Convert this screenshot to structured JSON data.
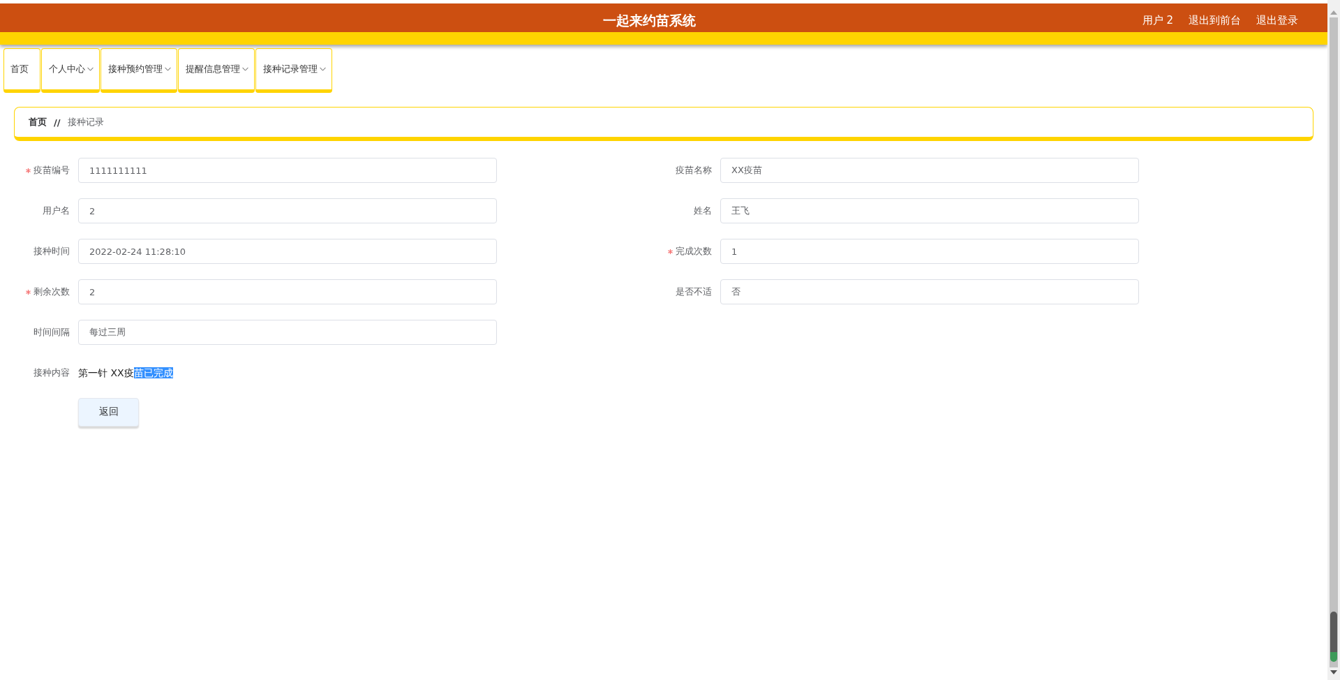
{
  "header": {
    "title": "一起来约苗系统",
    "links": [
      "用户 2",
      "退出到前台",
      "退出登录"
    ]
  },
  "nav": [
    {
      "label": "首页",
      "has_dropdown": false
    },
    {
      "label": "个人中心",
      "has_dropdown": true
    },
    {
      "label": "接种预约管理",
      "has_dropdown": true
    },
    {
      "label": "提醒信息管理",
      "has_dropdown": true
    },
    {
      "label": "接种记录管理",
      "has_dropdown": true
    }
  ],
  "breadcrumb": {
    "home": "首页",
    "separator": "//",
    "current": "接种记录"
  },
  "form": {
    "fields": [
      {
        "label": "疫苗编号",
        "required": true,
        "value": "1111111111"
      },
      {
        "label": "疫苗名称",
        "required": false,
        "value": "XX疫苗"
      },
      {
        "label": "用户名",
        "required": false,
        "value": "2"
      },
      {
        "label": "姓名",
        "required": false,
        "value": "王飞"
      },
      {
        "label": "接种时间",
        "required": false,
        "value": "2022-02-24 11:28:10"
      },
      {
        "label": "完成次数",
        "required": true,
        "value": "1"
      },
      {
        "label": "剩余次数",
        "required": true,
        "value": "2"
      },
      {
        "label": "是否不适",
        "required": false,
        "value": "否"
      },
      {
        "label": "时间间隔",
        "required": false,
        "value": "每过三周"
      }
    ],
    "content": {
      "label": "接种内容",
      "segments": [
        {
          "text": "第一针 XX疫",
          "selected": false
        },
        {
          "text": "苗已完成",
          "selected": true
        }
      ]
    },
    "back_button": "返回"
  }
}
